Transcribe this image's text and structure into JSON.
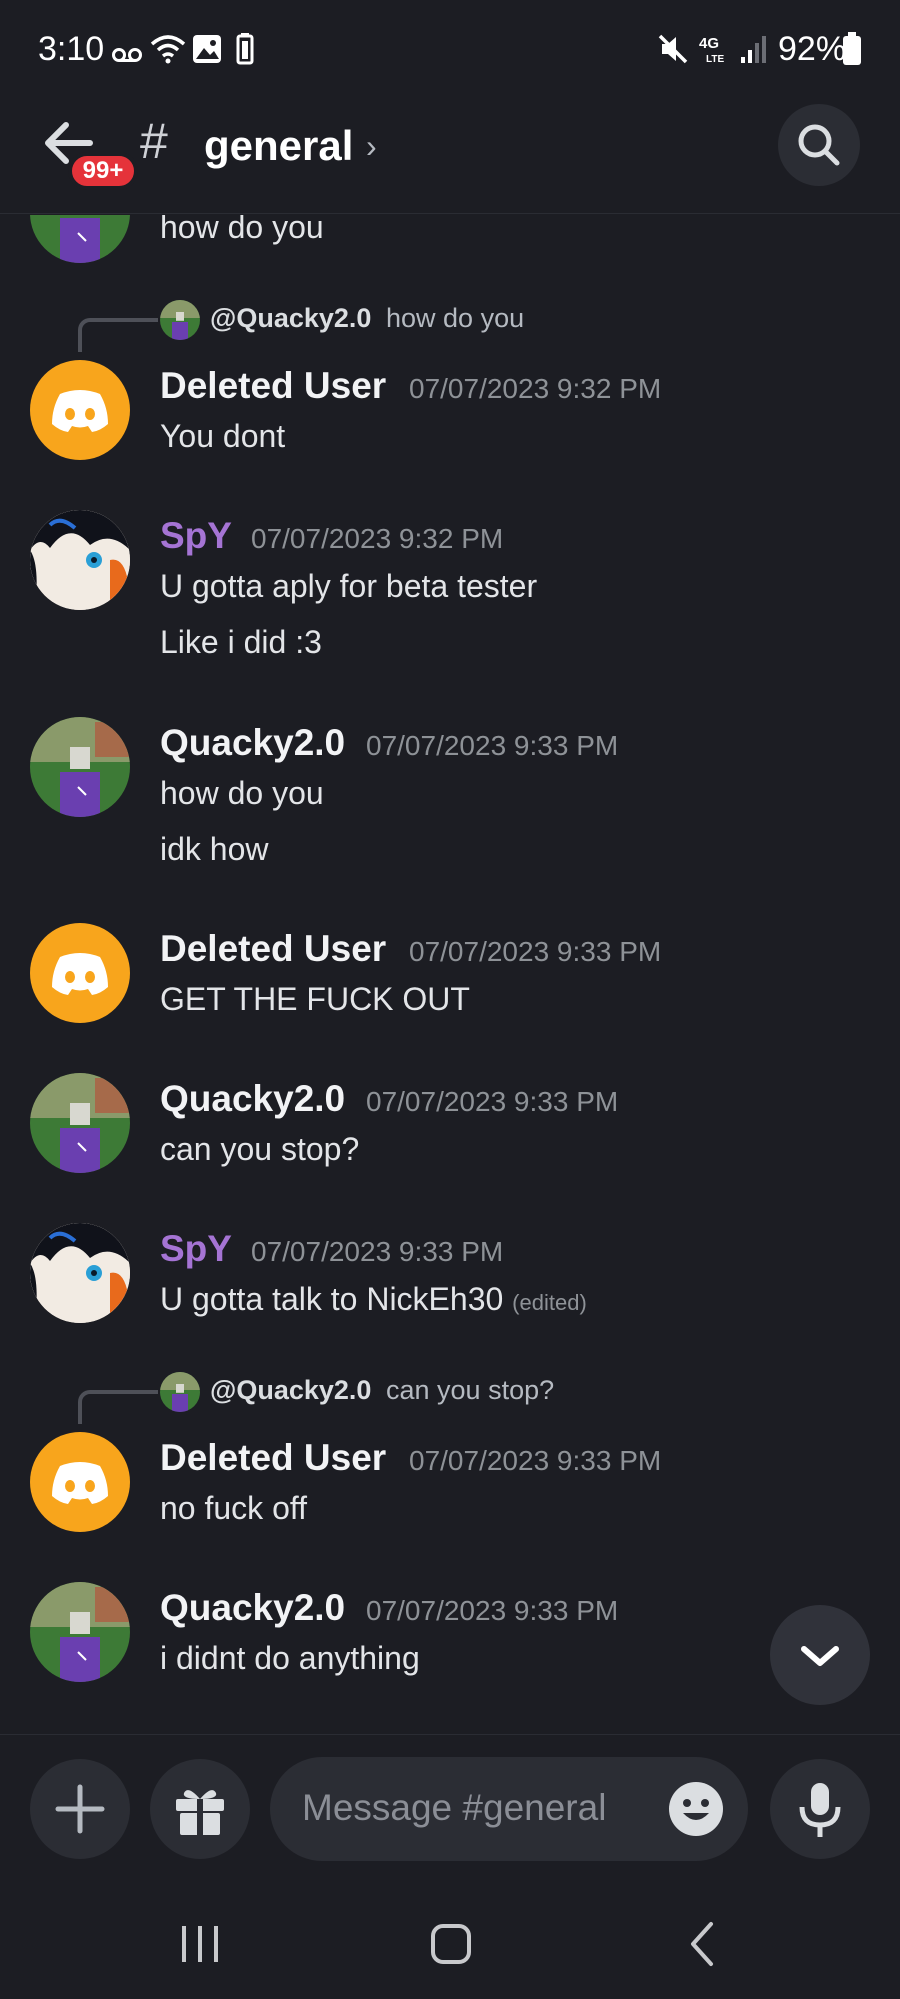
{
  "status_bar": {
    "time": "3:10",
    "battery": "92%"
  },
  "header": {
    "badge": "99+",
    "channel_hash": "#",
    "channel_name": "general",
    "chevron": "›"
  },
  "partial_message": {
    "text": "how do you"
  },
  "messages": [
    {
      "reply_to": {
        "mention": "@Quacky2.0",
        "text": "how do you"
      },
      "author": "Deleted User",
      "timestamp": "07/07/2023 9:32 PM",
      "lines": [
        "You dont"
      ]
    },
    {
      "author": "SpY",
      "timestamp": "07/07/2023 9:32 PM",
      "lines": [
        "U gotta aply for beta tester",
        "Like i did :3"
      ]
    },
    {
      "author": "Quacky2.0",
      "timestamp": "07/07/2023 9:33 PM",
      "lines": [
        "how do you",
        "idk how"
      ]
    },
    {
      "author": "Deleted User",
      "timestamp": "07/07/2023 9:33 PM",
      "lines": [
        "GET THE FUCK OUT"
      ]
    },
    {
      "author": "Quacky2.0",
      "timestamp": "07/07/2023 9:33 PM",
      "lines": [
        "can you stop?"
      ]
    },
    {
      "author": "SpY",
      "timestamp": "07/07/2023 9:33 PM",
      "lines": [
        "U gotta talk to NickEh30"
      ],
      "edited": "(edited)"
    },
    {
      "reply_to": {
        "mention": "@Quacky2.0",
        "text": "can you stop?"
      },
      "author": "Deleted User",
      "timestamp": "07/07/2023 9:33 PM",
      "lines": [
        "no fuck off"
      ]
    },
    {
      "author": "Quacky2.0",
      "timestamp": "07/07/2023 9:33 PM",
      "lines": [
        "i didnt do anything"
      ]
    }
  ],
  "composer": {
    "placeholder": "Message #general"
  },
  "colors": {
    "background": "#1c1d23",
    "discord_avatar": "#f8a51c",
    "spy_name": "#a574d4",
    "badge": "#e5333a"
  },
  "icons": [
    "back-arrow-icon",
    "search-icon",
    "discord-logo-icon",
    "chevron-down-icon",
    "plus-icon",
    "gift-icon",
    "emoji-icon",
    "microphone-icon",
    "recents-icon",
    "home-icon",
    "back-icon"
  ]
}
